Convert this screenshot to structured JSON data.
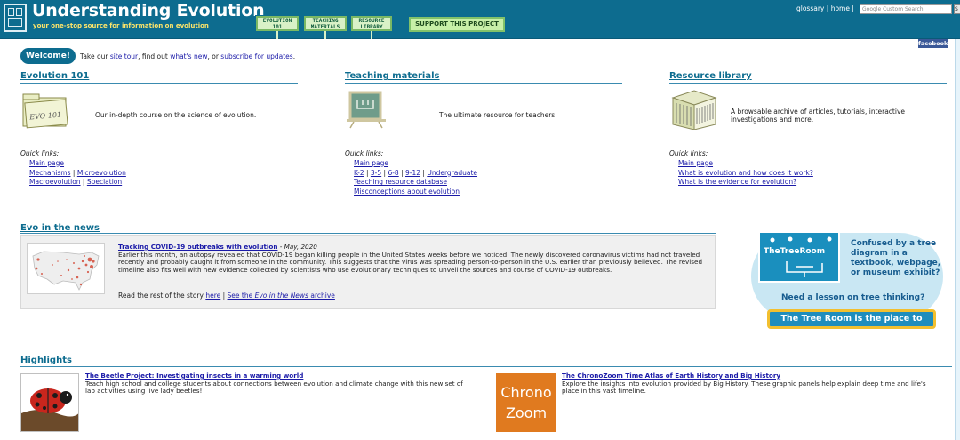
{
  "header": {
    "title": "Understanding Evolution",
    "tagline": "your one-stop source for information on evolution",
    "nav": [
      {
        "line1": "EVOLUTION",
        "line2": "101"
      },
      {
        "line1": "TEACHING",
        "line2": "MATERIALS"
      },
      {
        "line1": "RESOURCE",
        "line2": "LIBRARY"
      }
    ],
    "support_label": "SUPPORT THIS PROJECT",
    "glossary_label": "glossary",
    "home_label": "home",
    "separator": "|",
    "search_placeholder": "Google Custom Search",
    "search_button": "S",
    "facebook_label": "facebook"
  },
  "welcome": {
    "badge": "Welcome!",
    "text_1": "Take our ",
    "link_1": "site tour",
    "text_2": ", find out ",
    "link_2": "what's new",
    "text_3": ", or ",
    "link_3": "subscribe for updates",
    "text_4": "."
  },
  "columns": [
    {
      "title": "Evolution 101",
      "description": "Our in-depth course on the science of evolution.",
      "quick_label": "Quick links:",
      "links": [
        [
          "Main page"
        ],
        [
          "Mechanisms",
          "Microevolution"
        ],
        [
          "Macroevolution",
          "Speciation"
        ]
      ],
      "icon_text": "EVO 101"
    },
    {
      "title": "Teaching materials",
      "description": "The ultimate resource for teachers.",
      "quick_label": "Quick links:",
      "links": [
        [
          "Main page"
        ],
        [
          "K-2",
          "3-5",
          "6-8",
          "9-12",
          "Undergraduate"
        ],
        [
          "Teaching resource database"
        ],
        [
          "Misconceptions about evolution"
        ]
      ]
    },
    {
      "title": "Resource library",
      "description": "A browsable archive of articles, tutorials, interactive investigations and more.",
      "quick_label": "Quick links:",
      "links": [
        [
          "Main page"
        ],
        [
          "What is evolution and how does it work?"
        ],
        [
          "What is the evidence for evolution?"
        ]
      ]
    }
  ],
  "news": {
    "section_title": "Evo in the news",
    "headline": "Tracking COVID-19 outbreaks with evolution",
    "date": " - May, 2020",
    "body": "Earlier this month, an autopsy revealed that COVID-19 began killing people in the United States weeks before we noticed. The newly discovered coronavirus victims had not traveled recently and probably caught it from someone in the community. This suggests that the virus was spreading person-to-person in the U.S. earlier than previously believed. The revised timeline also fits well with new evidence collected by scientists who use evolutionary techniques to unveil the sources and course of COVID-19 outbreaks.",
    "more_prefix": "Read the rest of the story ",
    "more_link": "here",
    "archive_prefix": "See the ",
    "archive_em": "Evo in the News",
    "archive_suffix": " archive"
  },
  "tree_room": {
    "sign_title": "TheTreeRoom",
    "confused": "Confused by a tree diagram in a textbook, webpage, or museum exhibit?",
    "lesson": "Need a lesson on tree thinking?",
    "cta": "The Tree Room is the place to start!"
  },
  "highlights": {
    "section_title": "Highlights",
    "items": [
      {
        "title": "The Beetle Project: Investigating insects in a warming world",
        "text": "Teach high school and college students about connections between evolution and climate change with this new set of lab activities using live lady beetles!"
      },
      {
        "title": "The ChronoZoom Time Atlas of Earth History and Big History",
        "text": "Explore the insights into evolution provided by Big History. These graphic panels help explain deep time and life's place in this vast timeline.",
        "image_line1": "Chrono",
        "image_line2": "Zoom"
      }
    ]
  }
}
